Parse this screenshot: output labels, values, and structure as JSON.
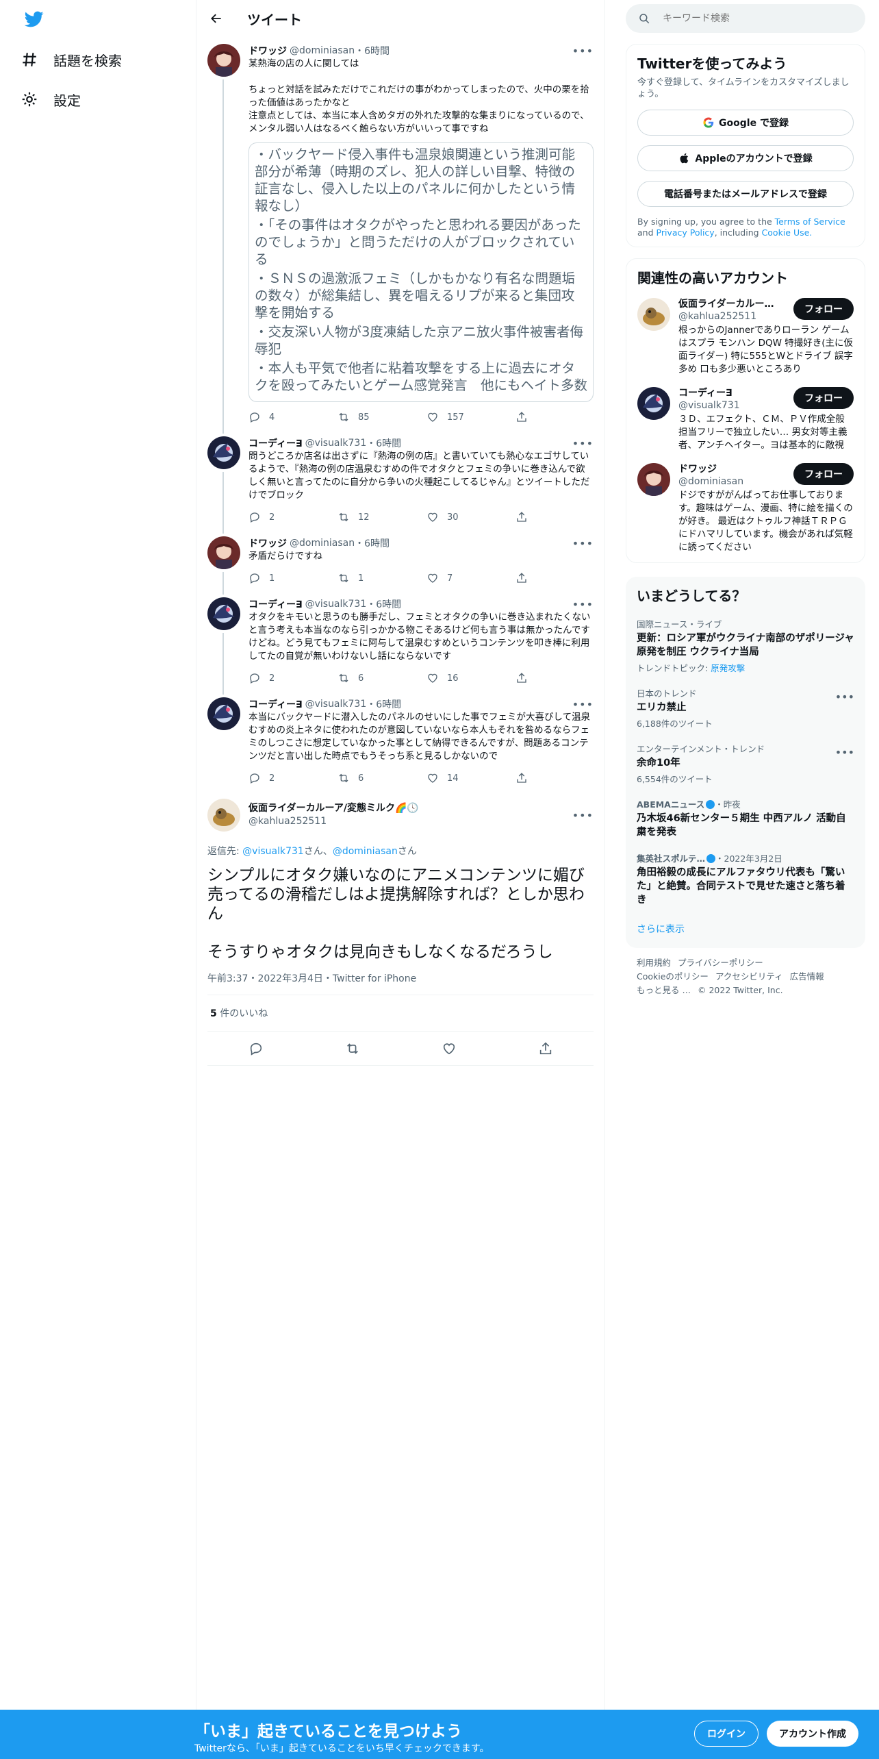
{
  "nav": {
    "explore_label": "話題を検索",
    "settings_label": "設定"
  },
  "header": {
    "title": "ツイート"
  },
  "thread": [
    {
      "name": "ドワッジ",
      "handle": "@dominiasan",
      "time": "・6時間",
      "text": "某熱海の店の人に関しては\n\nちょっと対話を試みただけでこれだけの事がわかってしまったので、火中の栗を拾った価値はあったかなと\n注意点としては、本当に本人含めタガの外れた攻撃的な集まりになっているので、メンタル弱い人はなるべく触らない方がいいって事ですね",
      "quote_lines": [
        "・バックヤード侵入事件も温泉娘関連という推測可能部分が希薄（時期のズレ、犯人の詳しい目撃、特徴の証言なし、侵入した以上のパネルに何かしたという情報なし）",
        "・「その事件はオタクがやったと思われる要因があったのでしょうか」と問うただけの人がブロックされている",
        "・ＳＮＳの過激派フェミ（しかもかなり有名な問題垢の数々）が総集結し、異を唱えるリプが来ると集団攻撃を開始する",
        "・交友深い人物が3度凍結した京アニ放火事件被害者侮辱犯",
        "・本人も平気で他者に粘着攻撃をする上に過去にオタクを殴ってみたいとゲーム感覚発言　他にもヘイト多数"
      ],
      "replies": "4",
      "retweets": "85",
      "likes": "157"
    },
    {
      "name": "コーディー∃",
      "handle": "@visualk731",
      "time": "・6時間",
      "text": "問うどころか店名は出さずに『熱海の例の店』と書いていても熱心なエゴサしているようで、『熱海の例の店温泉むすめの件でオタクとフェミの争いに巻き込んで欲しく無いと言ってたのに自分から争いの火種起こしてるじゃん』とツイートしただけでブロック",
      "replies": "2",
      "retweets": "12",
      "likes": "30"
    },
    {
      "name": "ドワッジ",
      "handle": "@dominiasan",
      "time": "・6時間",
      "text": "矛盾だらけですね",
      "replies": "1",
      "retweets": "1",
      "likes": "7"
    },
    {
      "name": "コーディー∃",
      "handle": "@visualk731",
      "time": "・6時間",
      "text": "オタクをキモいと思うのも勝手だし、フェミとオタクの争いに巻き込まれたくないと言う考えも本当なのなら引っかかる物こそあるけど何も言う事は無かったんですけどね。どう見てもフェミに阿与して温泉むすめというコンテンツを叩き棒に利用してたの自覚が無いわけないし話にならないです",
      "replies": "2",
      "retweets": "6",
      "likes": "16"
    },
    {
      "name": "コーディー∃",
      "handle": "@visualk731",
      "time": "・6時間",
      "text": "本当にバックヤードに潜入したのパネルのせいにした事でフェミが大喜びして温泉むすめの炎上ネタに使われたのが意図していないなら本人もそれを咎めるならフェミのしつこさに想定していなかった事として納得できるんですが、問題あるコンテンツだと言い出した時点でもうそっち系と見るしかないので",
      "replies": "2",
      "retweets": "6",
      "likes": "14"
    }
  ],
  "focus": {
    "name": "仮面ライダーカルーア/変態ミルク🌈🕓",
    "handle": "@kahlua252511",
    "reply_prefix": "返信先: ",
    "reply_user1": "@visualk731",
    "reply_mid": "さん、",
    "reply_user2": "@dominiasan",
    "reply_suffix": "さん",
    "text": "シンプルにオタク嫌いなのにアニメコンテンツに媚び売ってるの滑稽だしはよ提携解除すれば？としか思わん\n\nそうすりゃオタクは見向きもしなくなるだろうし",
    "meta": "午前3:37・2022年3月4日・Twitter for iPhone",
    "likes_count": "5",
    "likes_label": " 件のいいね"
  },
  "search": {
    "placeholder": "キーワード検索"
  },
  "signup_card": {
    "title": "Twitterを使ってみよう",
    "subtitle": "今すぐ登録して、タイムラインをカスタマイズしましょう。",
    "google": "Google で登録",
    "apple": "Appleのアカウントで登録",
    "phone": "電話番号またはメールアドレスで登録",
    "terms_prefix": "By signing up, you agree to the ",
    "terms_tos": "Terms of Service",
    "terms_and": " and ",
    "terms_privacy": "Privacy Policy",
    "terms_including": ", including ",
    "terms_cookie": "Cookie Use."
  },
  "related": {
    "title": "関連性の高いアカウント",
    "follow_label": "フォロー",
    "accounts": [
      {
        "name": "仮面ライダーカルー…",
        "handle": "@kahlua252511",
        "bio": "根っからのJannerでありローラン ゲームはスプラ モンハン DQW 特撮好き(主に仮面ライダー) 特に555とWとドライブ 誤字多め 口も多少悪いところあり"
      },
      {
        "name": "コーディー∃",
        "handle": "@visualk731",
        "bio": "３Ｄ、エフェクト、ＣＭ、ＰＶ作成全般担当フリーで独立したい… 男女対等主義者、アンチヘイター。ヨは基本的に敵視"
      },
      {
        "name": "ドワッジ",
        "handle": "@dominiasan",
        "bio": "ドジですががんばってお仕事しております。趣味はゲーム、漫画、特に絵を描くのが好き。 最近はクトゥルフ神話ＴＲＰＧにドハマリしています。機会があれば気軽に誘ってください"
      }
    ]
  },
  "trends": {
    "title": "いまどうしてる？",
    "items": [
      {
        "context": "国際ニュース・ライブ",
        "title": "更新：ロシア軍がウクライナ南部のザポリージャ原発を制圧 ウクライナ当局",
        "sub_prefix": "トレンドトピック: ",
        "sub_link": "原発攻撃"
      },
      {
        "context": "日本のトレンド",
        "title": "エリカ禁止",
        "sub": "6,188件のツイート"
      },
      {
        "context": "エンターテインメント・トレンド",
        "title": "余命10年",
        "sub": "6,554件のツイート"
      },
      {
        "context_source": "ABEMAニュース",
        "context_time": "・昨夜",
        "title": "乃木坂46新センター５期生 中西アルノ 活動自粛を発表"
      },
      {
        "context_source": "集英社スポルテ…",
        "context_time": "・2022年3月2日",
        "title": "角田裕毅の成長にアルファタウリ代表も「驚いた」と絶賛。合同テストで見せた速さと落ち着き"
      }
    ],
    "show_more": "さらに表示"
  },
  "footer": {
    "items": [
      "利用規約",
      "プライバシーポリシー",
      "Cookieのポリシー",
      "アクセシビリティ",
      "広告情報",
      "もっと見る …",
      "© 2022 Twitter, Inc."
    ]
  },
  "bottom_bar": {
    "title": "「いま」起きていることを見つけよう",
    "subtitle": "Twitterなら、「いま」起きていることをいち早くチェックできます。",
    "login": "ログイン",
    "signup": "アカウント作成"
  },
  "colors": {
    "brand": "#1d9bf0",
    "text": "#0f1419",
    "muted": "#536471"
  }
}
